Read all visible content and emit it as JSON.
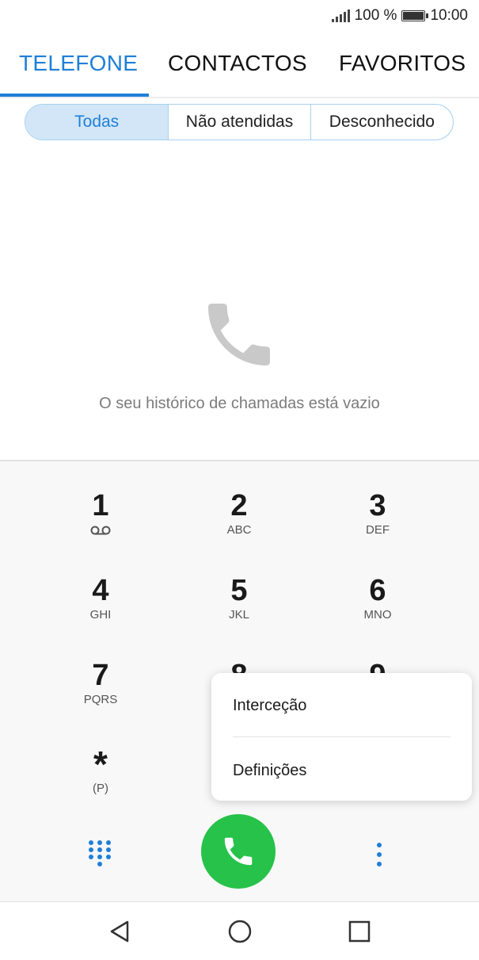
{
  "status_bar": {
    "battery_percent": "100 %",
    "time": "10:00"
  },
  "tabs": [
    {
      "label": "TELEFONE",
      "active": true
    },
    {
      "label": "CONTACTOS",
      "active": false
    },
    {
      "label": "FAVORITOS",
      "active": false
    }
  ],
  "filters": [
    {
      "label": "Todas",
      "active": true
    },
    {
      "label": "Não atendidas",
      "active": false
    },
    {
      "label": "Desconhecido",
      "active": false
    }
  ],
  "empty_state": {
    "icon": "phone-icon",
    "text": "O seu histórico de chamadas está vazio"
  },
  "dialpad": {
    "keys": [
      {
        "digit": "1",
        "letters": "",
        "icon": "voicemail-icon"
      },
      {
        "digit": "2",
        "letters": "ABC"
      },
      {
        "digit": "3",
        "letters": "DEF"
      },
      {
        "digit": "4",
        "letters": "GHI"
      },
      {
        "digit": "5",
        "letters": "JKL"
      },
      {
        "digit": "6",
        "letters": "MNO"
      },
      {
        "digit": "7",
        "letters": "PQRS"
      },
      {
        "digit": "8",
        "letters": ""
      },
      {
        "digit": "9",
        "letters": ""
      },
      {
        "digit": "*",
        "letters": "(P)"
      }
    ]
  },
  "menu": {
    "items": [
      "Interceção",
      "Definições"
    ]
  },
  "colors": {
    "accent": "#1f7fd8",
    "call": "#27c24a"
  }
}
